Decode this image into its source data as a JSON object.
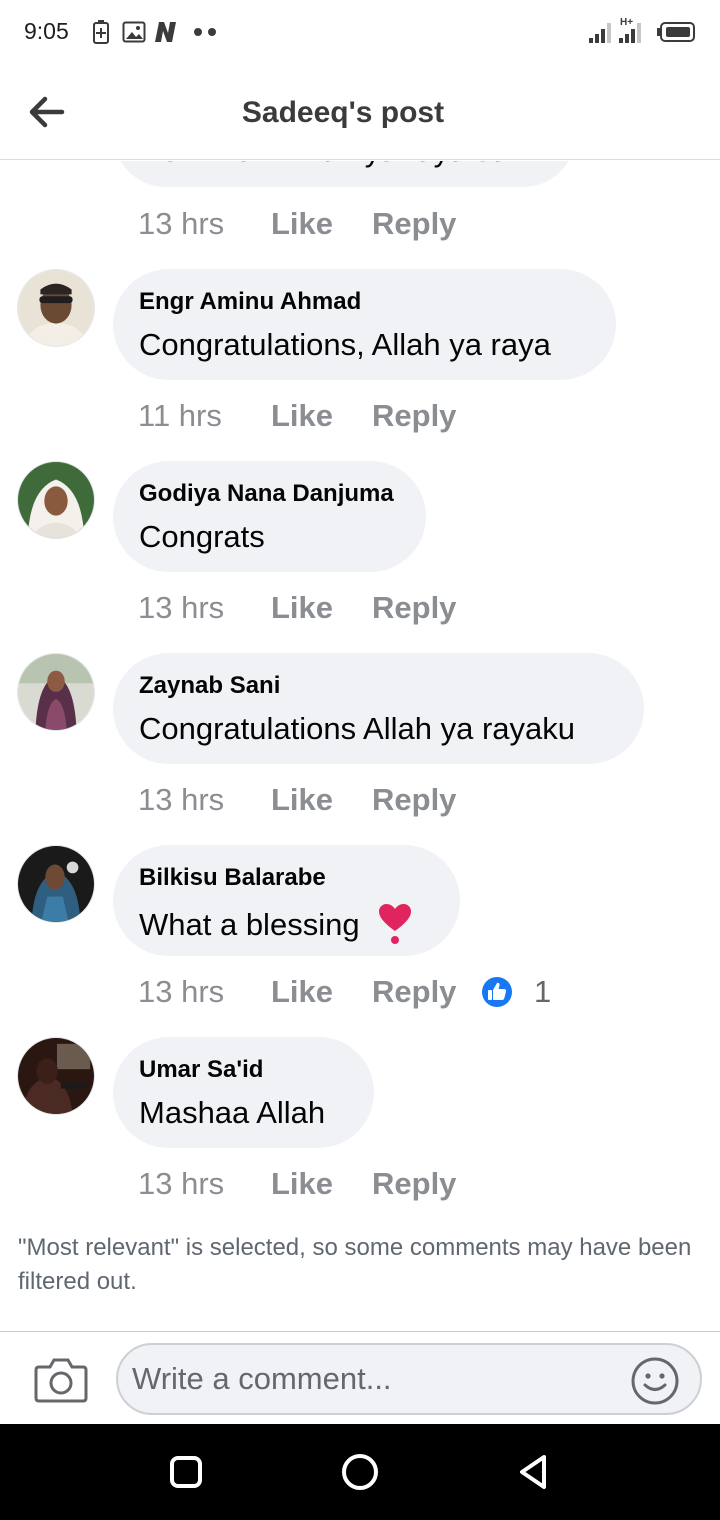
{
  "status_bar": {
    "time": "9:05",
    "left_icons": [
      "battery-saver-icon",
      "gallery-icon",
      "app-n-icon",
      "dots-icon"
    ],
    "right_icons": [
      "signal-icon",
      "signal-hplus-icon",
      "battery-icon"
    ],
    "network_label": "H+"
  },
  "header": {
    "title": "Sadeeq's post",
    "back_icon": "back-arrow-icon"
  },
  "partial_comment": {
    "text": "iken Allah. Allah ya raya su.",
    "time": "13 hrs",
    "like_label": "Like",
    "reply_label": "Reply"
  },
  "comments": [
    {
      "author": "Engr Aminu Ahmad",
      "text": "Congratulations, Allah ya raya",
      "time": "11 hrs",
      "like_label": "Like",
      "reply_label": "Reply"
    },
    {
      "author": "Godiya Nana Danjuma",
      "text": "Congrats",
      "time": "13 hrs",
      "like_label": "Like",
      "reply_label": "Reply"
    },
    {
      "author": "Zaynab Sani",
      "text": "Congratulations Allah ya rayaku",
      "time": "13 hrs",
      "like_label": "Like",
      "reply_label": "Reply"
    },
    {
      "author": "Bilkisu Balarabe",
      "text": "What a blessing",
      "emoji": "❣️",
      "time": "13 hrs",
      "like_label": "Like",
      "reply_label": "Reply",
      "reaction": "like-reaction-icon",
      "reaction_count": "1"
    },
    {
      "author": "Umar Sa'id",
      "text": "Mashaa Allah",
      "time": "13 hrs",
      "like_label": "Like",
      "reply_label": "Reply"
    }
  ],
  "filter_note": "\"Most relevant\" is selected, so some comments may have been filtered out.",
  "composer": {
    "placeholder": "Write a comment...",
    "camera_icon": "camera-icon",
    "emoji_icon": "emoji-icon"
  },
  "nav_bar": {
    "buttons": [
      "recents-square-icon",
      "home-circle-icon",
      "back-triangle-icon"
    ]
  },
  "colors": {
    "bubble": "#f0f2f5",
    "secondary_text": "#8a8d91",
    "like_blue": "#1877f2",
    "heart_red": "#e0245e"
  }
}
